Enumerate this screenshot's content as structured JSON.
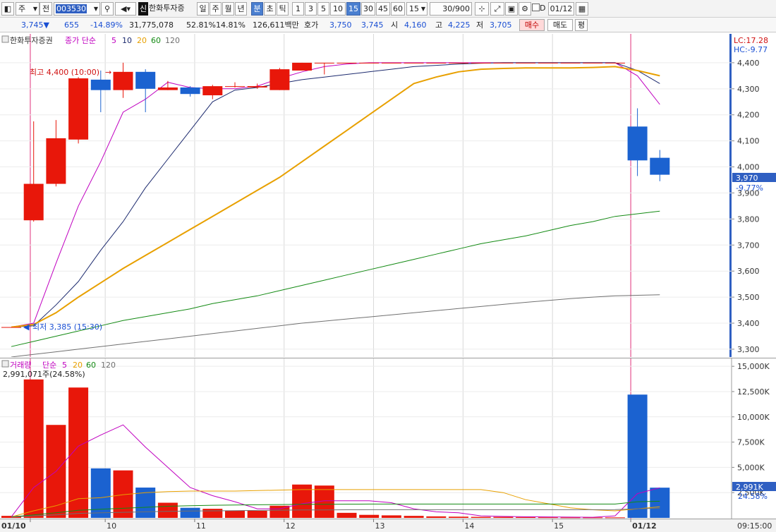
{
  "toolbar": {
    "mode": "주",
    "prev_label": "전",
    "code": "003530",
    "company": "한화투자증",
    "credit_icon": "신",
    "periods": [
      "일",
      "주",
      "월",
      "년",
      "분",
      "초",
      "틱"
    ],
    "active_period": "분",
    "intervals": [
      "1",
      "3",
      "5",
      "10",
      "15",
      "30",
      "45",
      "60"
    ],
    "active_interval": "15",
    "interval_select": "15",
    "count": "30",
    "count_total": "/900",
    "checkbox_label": "D",
    "date": "01/12"
  },
  "quote": {
    "price": "3,745",
    "direction": "▼",
    "change": "655",
    "change_pct": "-14.89%",
    "volume": "31,775,078",
    "rate1": "52.81%",
    "rate2": "14.81%",
    "amount": "126,611백만",
    "ask_label": "호가",
    "ask1": "3,750",
    "ask2": "3,745",
    "open_label": "시",
    "open": "4,160",
    "high_label": "고",
    "high": "4,225",
    "low_label": "저",
    "low": "3,705",
    "buy_btn": "매수",
    "sell_btn": "매도",
    "eval_btn": "평"
  },
  "price_panel": {
    "name": "한화투자증권",
    "legend_prefix": "종가 단순",
    "legend": [
      {
        "label": "5",
        "color": "#c000c0"
      },
      {
        "label": "10",
        "color": "#1c2a6e"
      },
      {
        "label": "20",
        "color": "#e8a000"
      },
      {
        "label": "60",
        "color": "#138a13"
      },
      {
        "label": "120",
        "color": "#707070"
      }
    ],
    "lc": "LC:17.28",
    "hc": "HC:-9.77",
    "y_ticks": [
      "4,400",
      "4,300",
      "4,200",
      "4,100",
      "4,000",
      "3,900",
      "3,800",
      "3,700",
      "3,600",
      "3,500",
      "3,400",
      "3,300"
    ],
    "y_range": [
      3270,
      4500
    ],
    "high_annot": "최고 4,400 (10:00)",
    "low_annot": "최저 3,385 (15:30)",
    "current_price": "3,970",
    "current_pct": "-9.77%"
  },
  "vol_panel": {
    "title": "거래량",
    "legend_prefix": "단순",
    "legend": [
      {
        "label": "5",
        "color": "#c000c0"
      },
      {
        "label": "20",
        "color": "#e8a000"
      },
      {
        "label": "60",
        "color": "#138a13"
      },
      {
        "label": "120",
        "color": "#707070"
      }
    ],
    "summary": "2,991,071주(24.58%)",
    "y_ticks": [
      "15,000K",
      "12,500K",
      "10,000K",
      "7,500K",
      "5,000K",
      "2,500K"
    ],
    "y_range": [
      0,
      15500
    ],
    "current_volume": "2,991K",
    "current_pct": "24.58%"
  },
  "x_axis": {
    "ticks": [
      "01/10",
      "10",
      "11",
      "12",
      "13",
      "14",
      "15",
      "01/12"
    ],
    "time": "09:15:00"
  },
  "chart_data": {
    "type": "candlestick",
    "title": "한화투자증권",
    "candles": [
      {
        "open": 3385,
        "high": 3385,
        "low": 3385,
        "close": 3385
      },
      {
        "open": 3795,
        "high": 4175,
        "low": 3790,
        "close": 3935
      },
      {
        "open": 3935,
        "high": 4180,
        "low": 3925,
        "close": 4110
      },
      {
        "open": 4105,
        "high": 4345,
        "low": 4090,
        "close": 4340
      },
      {
        "open": 4335,
        "high": 4370,
        "low": 4210,
        "close": 4295
      },
      {
        "open": 4295,
        "high": 4400,
        "low": 4265,
        "close": 4365
      },
      {
        "open": 4365,
        "high": 4375,
        "low": 4210,
        "close": 4300
      },
      {
        "open": 4295,
        "high": 4330,
        "low": 4295,
        "close": 4305
      },
      {
        "open": 4305,
        "high": 4310,
        "low": 4270,
        "close": 4280
      },
      {
        "open": 4275,
        "high": 4315,
        "low": 4260,
        "close": 4310
      },
      {
        "open": 4310,
        "high": 4325,
        "low": 4305,
        "close": 4310
      },
      {
        "open": 4305,
        "high": 4320,
        "low": 4300,
        "close": 4310
      },
      {
        "open": 4295,
        "high": 4380,
        "low": 4295,
        "close": 4375
      },
      {
        "open": 4370,
        "high": 4400,
        "low": 4370,
        "close": 4400
      },
      {
        "open": 4400,
        "high": 4400,
        "low": 4355,
        "close": 4400
      },
      {
        "open": 4400,
        "high": 4400,
        "low": 4400,
        "close": 4400
      },
      {
        "open": 4400,
        "high": 4400,
        "low": 4400,
        "close": 4400
      },
      {
        "open": 4400,
        "high": 4400,
        "low": 4400,
        "close": 4400
      },
      {
        "open": 4400,
        "high": 4400,
        "low": 4400,
        "close": 4400
      },
      {
        "open": 4400,
        "high": 4400,
        "low": 4400,
        "close": 4400
      },
      {
        "open": 4400,
        "high": 4400,
        "low": 4400,
        "close": 4400
      },
      {
        "open": 4400,
        "high": 4400,
        "low": 4400,
        "close": 4400
      },
      {
        "open": 4400,
        "high": 4400,
        "low": 4400,
        "close": 4400
      },
      {
        "open": 4400,
        "high": 4400,
        "low": 4400,
        "close": 4400
      },
      {
        "open": 4400,
        "high": 4400,
        "low": 4400,
        "close": 4400
      },
      {
        "open": 4400,
        "high": 4400,
        "low": 4400,
        "close": 4400
      },
      {
        "open": 4400,
        "high": 4400,
        "low": 4400,
        "close": 4400
      },
      {
        "open": 4400,
        "high": 4400,
        "low": 4400,
        "close": 4400
      },
      {
        "open": 4155,
        "high": 4225,
        "low": 3965,
        "close": 4025
      },
      {
        "open": 4035,
        "high": 4065,
        "low": 3945,
        "close": 3970
      }
    ],
    "volume": [
      200,
      13700,
      9200,
      12900,
      4900,
      4700,
      3000,
      1500,
      1000,
      900,
      700,
      700,
      1200,
      3300,
      3200,
      500,
      300,
      250,
      200,
      150,
      120,
      100,
      100,
      80,
      60,
      50,
      50,
      50,
      12200,
      2991
    ],
    "ma_price": [
      {
        "name": "5",
        "values": [
          3385,
          3400,
          3630,
          3850,
          4020,
          4210,
          4260,
          4325,
          4305,
          4300,
          4300,
          4310,
          4340,
          4365,
          4385,
          4395,
          4400,
          4400,
          4400,
          4400,
          4400,
          4400,
          4400,
          4400,
          4400,
          4400,
          4400,
          4400,
          4350,
          4240
        ]
      },
      {
        "name": "10",
        "values": [
          3385,
          3390,
          3470,
          3560,
          3680,
          3790,
          3920,
          4030,
          4140,
          4250,
          4295,
          4305,
          4320,
          4335,
          4345,
          4355,
          4365,
          4375,
          4385,
          4390,
          4395,
          4398,
          4400,
          4400,
          4400,
          4400,
          4400,
          4400,
          4370,
          4320
        ]
      },
      {
        "name": "20",
        "values": [
          3385,
          3395,
          3440,
          3500,
          3555,
          3610,
          3660,
          3710,
          3760,
          3810,
          3860,
          3910,
          3960,
          4020,
          4080,
          4140,
          4200,
          4260,
          4320,
          4345,
          4365,
          4375,
          4378,
          4380,
          4380,
          4380,
          4382,
          4385,
          4370,
          4350
        ]
      },
      {
        "name": "60",
        "values": [
          3310,
          3330,
          3350,
          3370,
          3390,
          3410,
          3425,
          3440,
          3455,
          3475,
          3490,
          3505,
          3525,
          3545,
          3565,
          3585,
          3605,
          3625,
          3645,
          3665,
          3685,
          3705,
          3720,
          3735,
          3755,
          3775,
          3790,
          3810,
          3820,
          3830
        ]
      },
      {
        "name": "120",
        "values": [
          3270,
          3280,
          3290,
          3300,
          3310,
          3320,
          3330,
          3340,
          3350,
          3360,
          3370,
          3380,
          3390,
          3400,
          3408,
          3416,
          3424,
          3432,
          3440,
          3448,
          3456,
          3464,
          3472,
          3480,
          3487,
          3494,
          3500,
          3505,
          3507,
          3509
        ]
      }
    ],
    "ma_volume": [
      {
        "name": "5",
        "values": [
          100,
          3000,
          4600,
          7100,
          8200,
          9200,
          7000,
          5000,
          3000,
          2200,
          1600,
          900,
          900,
          1400,
          1700,
          1700,
          1700,
          1500,
          900,
          600,
          500,
          200,
          150,
          110,
          100,
          80,
          60,
          200,
          2400,
          2980
        ]
      },
      {
        "name": "20",
        "values": [
          100,
          700,
          1200,
          1900,
          2000,
          2300,
          2500,
          2600,
          2650,
          2650,
          2650,
          2700,
          2750,
          2800,
          2800,
          2800,
          2800,
          2800,
          2800,
          2800,
          2800,
          2800,
          2500,
          1800,
          1400,
          1000,
          800,
          700,
          900,
          1100
        ]
      },
      {
        "name": "60",
        "values": [
          100,
          300,
          500,
          750,
          850,
          950,
          1050,
          1150,
          1200,
          1250,
          1280,
          1300,
          1320,
          1340,
          1350,
          1360,
          1370,
          1370,
          1370,
          1370,
          1370,
          1370,
          1370,
          1370,
          1370,
          1370,
          1370,
          1370,
          1600,
          1650
        ]
      },
      {
        "name": "120",
        "values": [
          80,
          200,
          300,
          450,
          500,
          550,
          600,
          640,
          680,
          700,
          720,
          740,
          760,
          780,
          790,
          800,
          810,
          810,
          810,
          810,
          810,
          810,
          810,
          810,
          810,
          810,
          810,
          820,
          900,
          950
        ]
      }
    ]
  }
}
